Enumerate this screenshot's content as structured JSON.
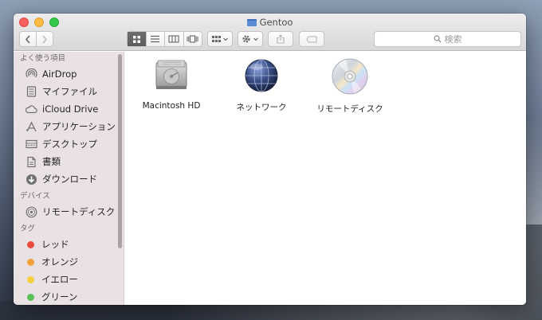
{
  "window": {
    "title": "Gentoo"
  },
  "search": {
    "placeholder": "検索"
  },
  "sidebar": {
    "sections": [
      {
        "header": "よく使う項目",
        "items": [
          {
            "label": "AirDrop",
            "icon": "airdrop-icon"
          },
          {
            "label": "マイファイル",
            "icon": "all-my-files-icon"
          },
          {
            "label": "iCloud Drive",
            "icon": "cloud-icon"
          },
          {
            "label": "アプリケーション",
            "icon": "applications-icon"
          },
          {
            "label": "デスクトップ",
            "icon": "desktop-icon"
          },
          {
            "label": "書類",
            "icon": "documents-icon"
          },
          {
            "label": "ダウンロード",
            "icon": "downloads-icon"
          }
        ]
      },
      {
        "header": "デバイス",
        "items": [
          {
            "label": "リモートディスク",
            "icon": "remote-disc-icon"
          }
        ]
      },
      {
        "header": "タグ",
        "items": [
          {
            "label": "レッド",
            "color": "#ec4a41"
          },
          {
            "label": "オレンジ",
            "color": "#f0a13a"
          },
          {
            "label": "イエロー",
            "color": "#f4d03f"
          },
          {
            "label": "グリーン",
            "color": "#5ac05a"
          }
        ]
      }
    ]
  },
  "content": {
    "items": [
      {
        "label": "Macintosh HD",
        "icon": "hard-drive-icon"
      },
      {
        "label": "ネットワーク",
        "icon": "network-globe-icon"
      },
      {
        "label": "リモートディスク",
        "icon": "optical-disc-icon"
      }
    ]
  }
}
